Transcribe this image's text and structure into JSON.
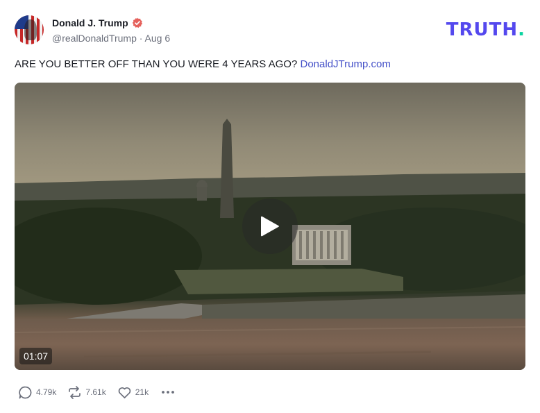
{
  "author": {
    "display_name": "Donald J. Trump",
    "handle_line": "@realDonaldTrump · Aug 6",
    "verified_icon": "verified-badge-icon"
  },
  "brand": {
    "logo_text": "TRUTH",
    "logo_dot": ".",
    "logo_color": "#5448ee",
    "logo_dot_color": "#0ad4a1"
  },
  "post": {
    "text": "ARE YOU BETTER OFF THAN YOU WERE 4 YEARS AGO?",
    "link_text": "DonaldJTrump.com",
    "link_color": "#4450c8"
  },
  "media": {
    "type": "video",
    "duration": "01:07",
    "play_icon": "play-icon"
  },
  "actions": {
    "replies": {
      "icon": "reply-icon",
      "count": "4.79k"
    },
    "retruths": {
      "icon": "retruth-icon",
      "count": "7.61k"
    },
    "likes": {
      "icon": "heart-icon",
      "count": "21k"
    },
    "more": {
      "icon": "more-icon"
    }
  }
}
